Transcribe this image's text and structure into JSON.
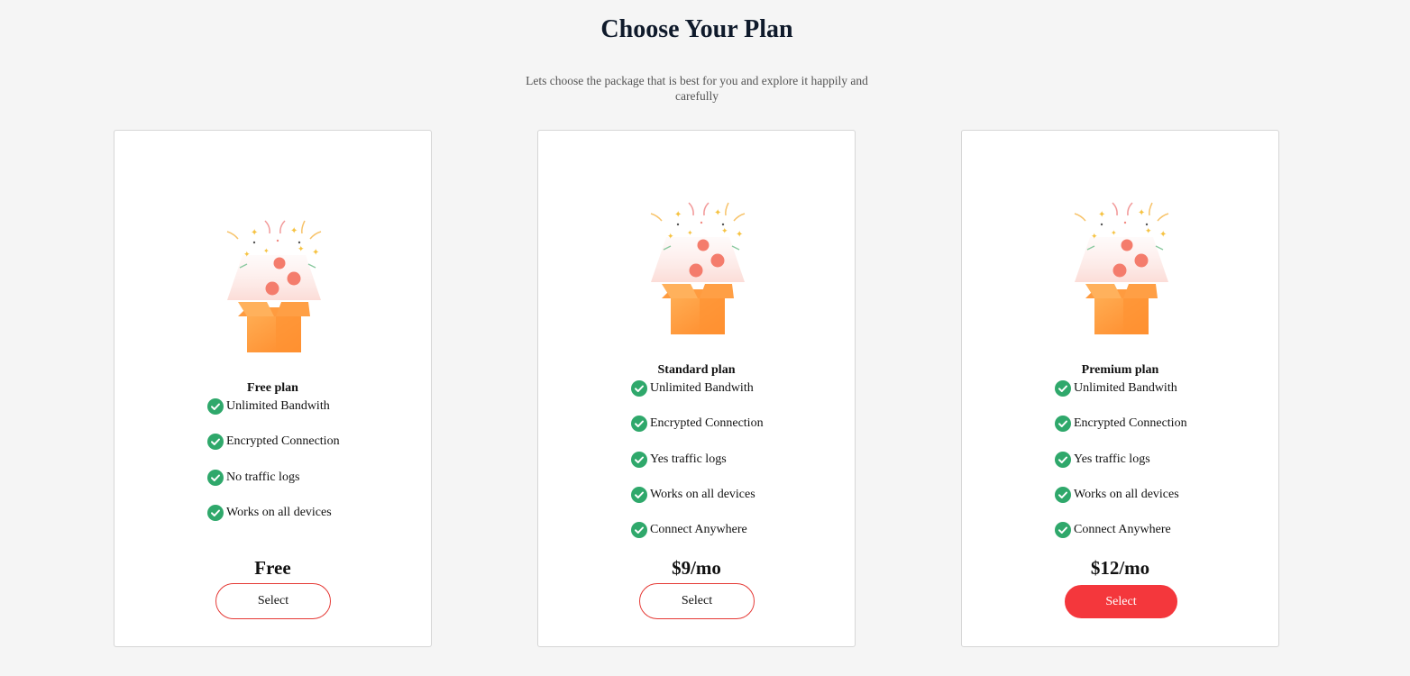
{
  "header": {
    "title": "Choose Your Plan",
    "subtitle": "Lets choose the package that is best for you and explore it happily and carefully"
  },
  "colors": {
    "accent": "#f4373c",
    "check": "#2fa86b",
    "box": "#ff9a3c"
  },
  "plans": [
    {
      "name": "Free plan",
      "features": [
        "Unlimited Bandwith",
        "Encrypted Connection",
        "No traffic logs",
        "Works on all devices"
      ],
      "price": "Free",
      "button": "Select"
    },
    {
      "name": "Standard plan",
      "features": [
        "Unlimited Bandwith",
        "Encrypted Connection",
        "Yes traffic logs",
        "Works on all devices",
        "Connect Anywhere"
      ],
      "price": "$9/mo",
      "button": "Select"
    },
    {
      "name": "Premium plan",
      "features": [
        "Unlimited Bandwith",
        "Encrypted Connection",
        "Yes traffic logs",
        "Works on all devices",
        "Connect Anywhere"
      ],
      "price": "$12/mo",
      "button": "Select"
    }
  ]
}
